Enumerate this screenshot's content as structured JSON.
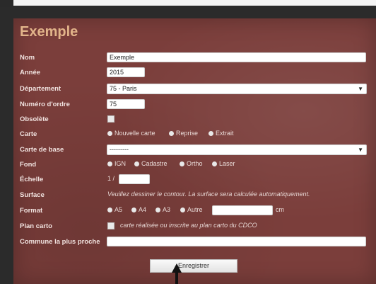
{
  "form": {
    "title": "Exemple",
    "labels": {
      "nom": "Nom",
      "annee": "Année",
      "departement": "Département",
      "numero": "Numéro d'ordre",
      "obsolete": "Obsolète",
      "carte": "Carte",
      "carte_base": "Carte de base",
      "fond": "Fond",
      "echelle": "Échelle",
      "surface": "Surface",
      "format": "Format",
      "plan_carto": "Plan carto",
      "commune": "Commune la plus proche"
    },
    "values": {
      "nom": "Exemple",
      "annee": "2015",
      "departement": "75 - Paris",
      "numero": "75",
      "carte_base": "---------",
      "echelle_prefix": "1 /",
      "echelle": "",
      "format_autre": "",
      "commune": ""
    },
    "carte_options": [
      "Nouvelle carte",
      "Reprise",
      "Extrait"
    ],
    "fond_options": [
      "IGN",
      "Cadastre",
      "Ortho",
      "Laser"
    ],
    "format_options": [
      "A5",
      "A4",
      "A3",
      "Autre"
    ],
    "format_unit": "cm",
    "surface_hint": "Veuillez dessiner le contour. La surface sera calculée automatiquement.",
    "plan_carto_hint": "carte réalisée ou inscrite au plan carto du CDCO",
    "submit_label": "Enregistrer",
    "select_arrow": "▼"
  }
}
